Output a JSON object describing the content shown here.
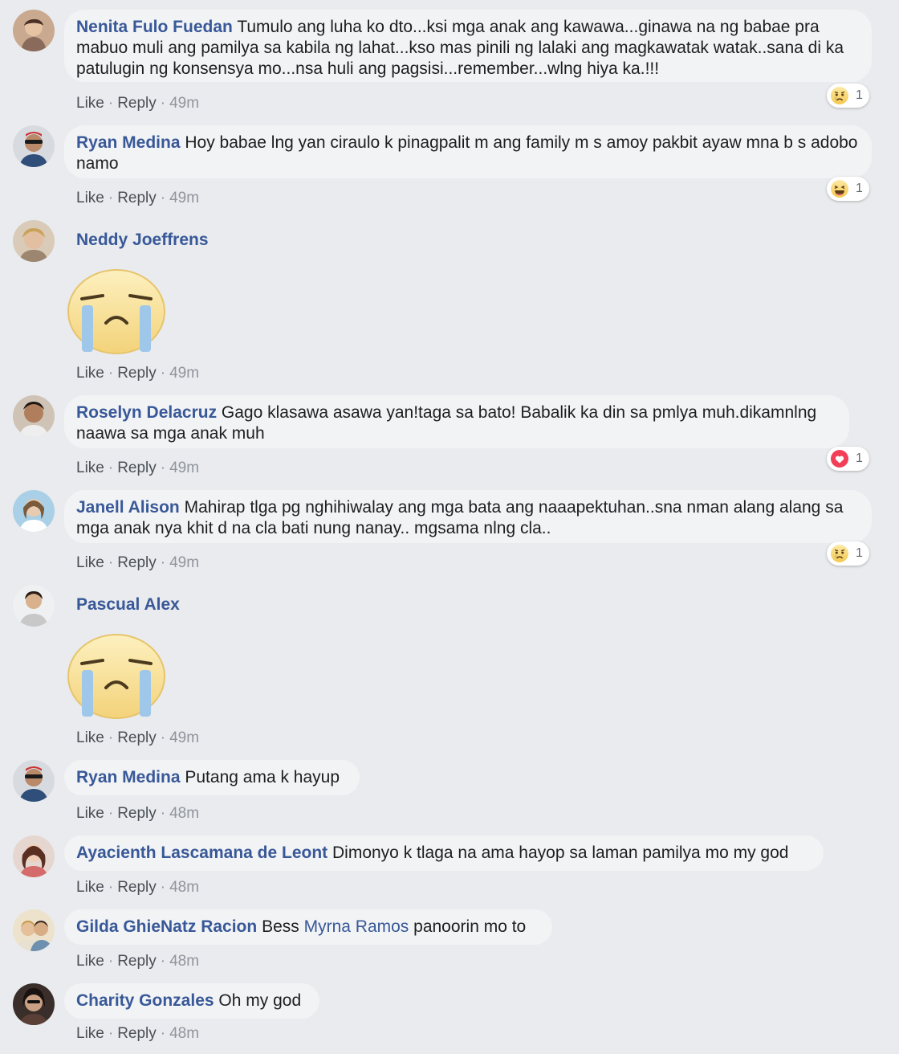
{
  "actions": {
    "like": "Like",
    "reply": "Reply",
    "sep": "·"
  },
  "comments": [
    {
      "name": "Nenita Fulo Fuedan",
      "text": "Tumulo ang luha ko dto...ksi mga anak ang kawawa...ginawa na ng babae pra mabuo muli ang pamilya sa kabila ng lahat...kso mas pinili ng lalaki ang magkawatak watak..sana di ka patulugin ng konsensya mo...nsa huli ang pagsisi...remember...wlng hiya ka.!!!",
      "time": "49m",
      "reaction": {
        "icon": "sad-reaction-icon",
        "count": "1"
      }
    },
    {
      "name": "Ryan Medina",
      "text": "Hoy babae lng yan ciraulo k pinagpalit m ang family m s amoy pakbit ayaw mna b s adobo namo",
      "time": "49m",
      "reaction": {
        "icon": "haha-reaction-icon",
        "count": "1"
      }
    },
    {
      "name": "Neddy Joeffrens",
      "sticker": "crying-face-sticker",
      "time": "49m"
    },
    {
      "name": "Roselyn Delacruz",
      "text": "Gago klasawa asawa yan!taga sa bato! Babalik ka din sa pmlya muh.dikamnlng naawa sa mga anak muh",
      "time": "49m",
      "reaction": {
        "icon": "love-reaction-icon",
        "count": "1"
      }
    },
    {
      "name": "Janell Alison",
      "text": "Mahirap tlga pg nghihiwalay ang mga bata ang naaapektuhan..sna nman alang alang sa mga anak nya khit d na cla bati nung nanay.. mgsama nlng cla..",
      "time": "49m",
      "reaction": {
        "icon": "sad-reaction-icon",
        "count": "1"
      }
    },
    {
      "name": "Pascual Alex",
      "sticker": "crying-face-sticker",
      "time": "49m"
    },
    {
      "name": "Ryan Medina",
      "text": "Putang ama k hayup",
      "time": "48m"
    },
    {
      "name": "Ayacienth Lascamana de Leont",
      "text": "Dimonyo k tlaga na ama hayop sa laman pamilya mo my god",
      "time": "48m"
    },
    {
      "name": "Gilda GhieNatz Racion",
      "text_before": "Bess",
      "mention": "Myrna Ramos",
      "text_after": "panoorin mo to",
      "time": "48m"
    },
    {
      "name": "Charity Gonzales",
      "text": "Oh my god",
      "time": "48m"
    }
  ],
  "colors": {
    "background": "#e9ebee",
    "bubble": "#f2f3f5",
    "name_link": "#385898",
    "text": "#1c1e21",
    "meta": "#90949c",
    "love": "#f33e58",
    "emoji_yellow": "#f7d36b"
  }
}
